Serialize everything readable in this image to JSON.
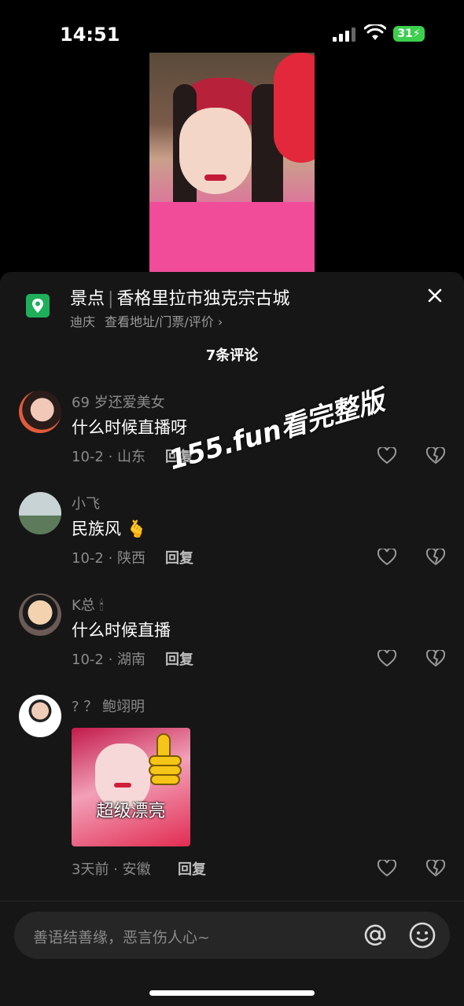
{
  "status_bar": {
    "time": "14:51",
    "battery": "31"
  },
  "poi": {
    "category": "景点",
    "name": "香格里拉市独克宗古城",
    "city": "迪庆",
    "link": "查看地址/门票/评价",
    "chevron": "›",
    "icon": "map-pin-icon"
  },
  "comments_count": "7条评论",
  "comments": [
    {
      "user": "69 岁还爱美女",
      "text": "什么时候直播呀",
      "meta": "10-2 · 山东",
      "reply": "回复"
    },
    {
      "user": "小飞",
      "text": "民族风 🫰",
      "meta": "10-2 · 陕西",
      "reply": "回复"
    },
    {
      "user": "K总 🕯",
      "text": "什么时候直播",
      "meta": "10-2 · 湖南",
      "reply": "回复"
    },
    {
      "user": "? ？ 鲍翊明",
      "sticker_text": "超级漂亮",
      "meta": "3天前 · 安徽",
      "reply": "回复"
    }
  ],
  "watermark": "155.fun看完整版",
  "input": {
    "placeholder": "善语结善缘，恶言伤人心~"
  },
  "colors": {
    "accent_green": "#1fae5a",
    "battery_green": "#3ccf4e",
    "sheet_bg": "#161616"
  }
}
